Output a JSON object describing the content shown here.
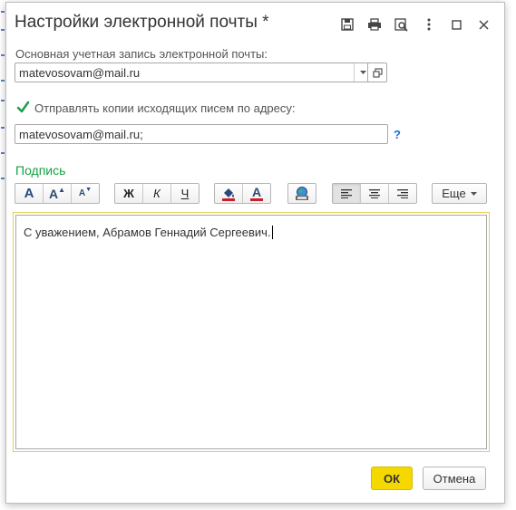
{
  "window": {
    "title": "Настройки электронной почты *",
    "icons": [
      "save-icon",
      "print-icon",
      "preview-icon",
      "more-menu-icon",
      "maximize-icon",
      "close-icon"
    ]
  },
  "account": {
    "label": "Основная учетная запись электронной почты:",
    "value": "matevosovam@mail.ru"
  },
  "copies": {
    "checked": true,
    "label": "Отправлять копии исходящих писем по адресу:",
    "value": "matevosovam@mail.ru;",
    "help": "?"
  },
  "signature": {
    "section_title": "Подпись",
    "toolbar": {
      "font_size_normal": "A",
      "font_size_increase": "A",
      "font_size_decrease": "A",
      "bold": "Ж",
      "italic": "К",
      "underline": "Ч",
      "text_color": "A",
      "align_active": "left",
      "more_label": "Еще"
    },
    "text": "С уважением, Абрамов Геннадий Сергеевич."
  },
  "footer": {
    "ok_label": "ОК",
    "cancel_label": "Отмена"
  },
  "colors": {
    "accent_green": "#17a043",
    "ok_yellow": "#f5d800",
    "link_blue": "#1a6fd0",
    "editor_focus": "#e2cf57"
  }
}
